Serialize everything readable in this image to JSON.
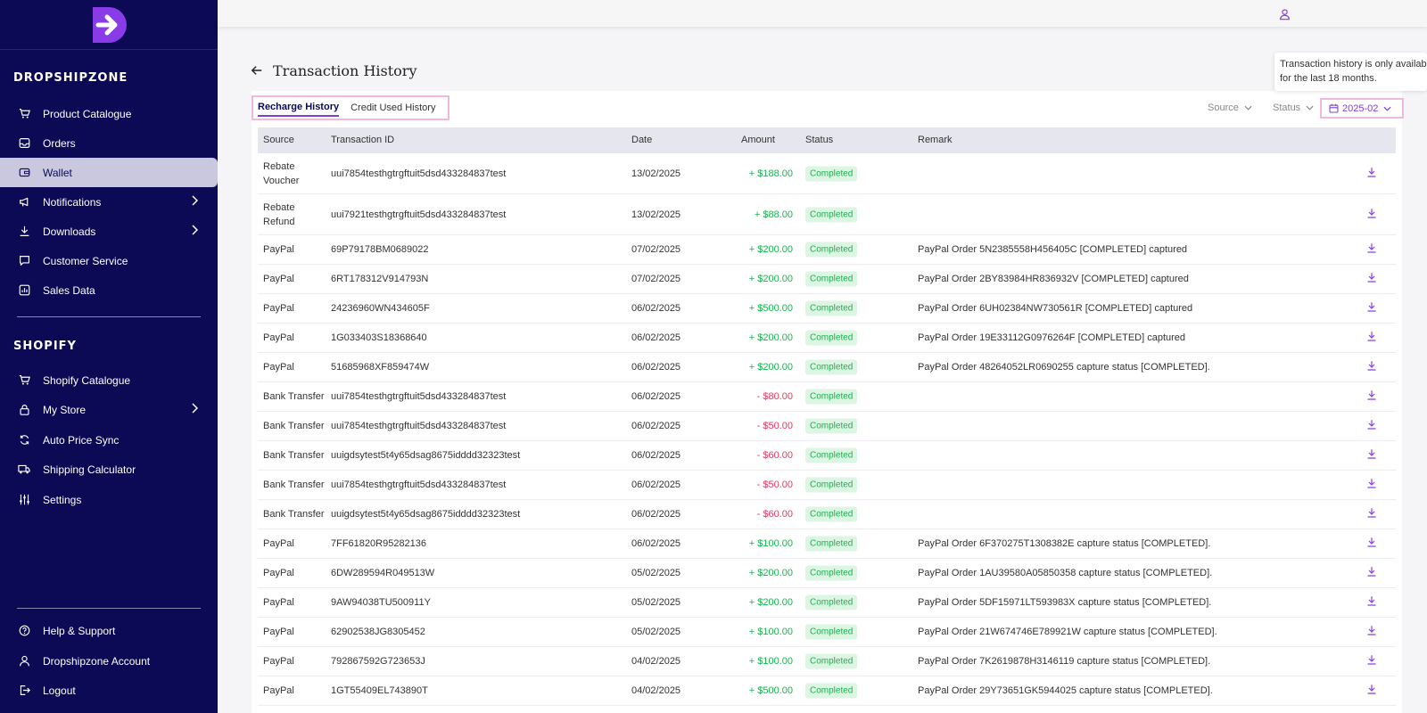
{
  "brand": {
    "logo_letter": "D"
  },
  "sidebar": {
    "dropshipzone_title": "DROPSHIPZONE",
    "shopify_title": "SHOPIFY",
    "items": [
      {
        "label": "Product Catalogue",
        "icon": "cart-icon"
      },
      {
        "label": "Orders",
        "icon": "inbox-icon"
      },
      {
        "label": "Wallet",
        "icon": "wallet-icon"
      },
      {
        "label": "Notifications",
        "icon": "megaphone-icon"
      },
      {
        "label": "Downloads",
        "icon": "download-icon"
      },
      {
        "label": "Customer Service",
        "icon": "chat-icon"
      },
      {
        "label": "Sales Data",
        "icon": "chart-icon"
      },
      {
        "label": "Shopify Catalogue",
        "icon": "cart-icon"
      },
      {
        "label": "My Store",
        "icon": "lock-icon"
      },
      {
        "label": "Auto Price Sync",
        "icon": "sync-icon"
      },
      {
        "label": "Shipping Calculator",
        "icon": "truck-icon"
      },
      {
        "label": "Settings",
        "icon": "sliders-icon"
      },
      {
        "label": "Help & Support",
        "icon": "help-icon"
      },
      {
        "label": "Dropshipzone Account",
        "icon": "user-icon"
      },
      {
        "label": "Logout",
        "icon": "logout-icon"
      }
    ]
  },
  "header": {
    "title": "Transaction History"
  },
  "tabs": [
    {
      "label": "Recharge History"
    },
    {
      "label": "Credit Used History"
    }
  ],
  "filters": {
    "source": "Source",
    "status": "Status",
    "date": "2025-02"
  },
  "tooltip": {
    "line1": "Transaction history is only available",
    "line2": "for the last 18 months."
  },
  "table": {
    "columns": {
      "source": "Source",
      "id": "Transaction ID",
      "date": "Date",
      "amount": "Amount",
      "status": "Status",
      "remark": "Remark"
    },
    "rows": [
      {
        "source": "Rebate Voucher",
        "id": "uui7854testhgtrgftuit5dsd433284837test",
        "date": "13/02/2025",
        "amount": "+ $188.00",
        "sign": "pos",
        "status": "Completed",
        "remark": ""
      },
      {
        "source": "Rebate Refund",
        "id": "uui7921testhgtrgftuit5dsd433284837test",
        "date": "13/02/2025",
        "amount": "+ $88.00",
        "sign": "pos",
        "status": "Completed",
        "remark": ""
      },
      {
        "source": "PayPal",
        "id": "69P79178BM0689022",
        "date": "07/02/2025",
        "amount": "+ $200.00",
        "sign": "pos",
        "status": "Completed",
        "remark": "PayPal Order 5N2385558H456405C [COMPLETED] captured"
      },
      {
        "source": "PayPal",
        "id": "6RT178312V914793N",
        "date": "07/02/2025",
        "amount": "+ $200.00",
        "sign": "pos",
        "status": "Completed",
        "remark": "PayPal Order 2BY83984HR836932V [COMPLETED] captured"
      },
      {
        "source": "PayPal",
        "id": "24236960WN434605F",
        "date": "06/02/2025",
        "amount": "+ $500.00",
        "sign": "pos",
        "status": "Completed",
        "remark": "PayPal Order 6UH02384NW730561R [COMPLETED] captured"
      },
      {
        "source": "PayPal",
        "id": "1G033403S18368640",
        "date": "06/02/2025",
        "amount": "+ $200.00",
        "sign": "pos",
        "status": "Completed",
        "remark": "PayPal Order 19E33112G0976264F [COMPLETED] captured"
      },
      {
        "source": "PayPal",
        "id": "51685968XF859474W",
        "date": "06/02/2025",
        "amount": "+ $200.00",
        "sign": "pos",
        "status": "Completed",
        "remark": "PayPal Order 48264052LR0690255 capture status [COMPLETED]."
      },
      {
        "source": "Bank Transfer",
        "id": "uui7854testhgtrgftuit5dsd433284837test",
        "date": "06/02/2025",
        "amount": "- $80.00",
        "sign": "neg",
        "status": "Completed",
        "remark": ""
      },
      {
        "source": "Bank Transfer",
        "id": "uui7854testhgtrgftuit5dsd433284837test",
        "date": "06/02/2025",
        "amount": "- $50.00",
        "sign": "neg",
        "status": "Completed",
        "remark": ""
      },
      {
        "source": "Bank Transfer",
        "id": "uuigdsytest5t4y65dsag8675idddd32323test",
        "date": "06/02/2025",
        "amount": "- $60.00",
        "sign": "neg",
        "status": "Completed",
        "remark": ""
      },
      {
        "source": "Bank Transfer",
        "id": "uui7854testhgtrgftuit5dsd433284837test",
        "date": "06/02/2025",
        "amount": "- $50.00",
        "sign": "neg",
        "status": "Completed",
        "remark": ""
      },
      {
        "source": "Bank Transfer",
        "id": "uuigdsytest5t4y65dsag8675idddd32323test",
        "date": "06/02/2025",
        "amount": "- $60.00",
        "sign": "neg",
        "status": "Completed",
        "remark": ""
      },
      {
        "source": "PayPal",
        "id": "7FF61820R95282136",
        "date": "06/02/2025",
        "amount": "+ $100.00",
        "sign": "pos",
        "status": "Completed",
        "remark": "PayPal Order 6F370275T1308382E capture status [COMPLETED]."
      },
      {
        "source": "PayPal",
        "id": "6DW289594R049513W",
        "date": "05/02/2025",
        "amount": "+ $200.00",
        "sign": "pos",
        "status": "Completed",
        "remark": "PayPal Order 1AU39580A05850358 capture status [COMPLETED]."
      },
      {
        "source": "PayPal",
        "id": "9AW94038TU500911Y",
        "date": "05/02/2025",
        "amount": "+ $200.00",
        "sign": "pos",
        "status": "Completed",
        "remark": "PayPal Order 5DF15971LT593983X capture status [COMPLETED]."
      },
      {
        "source": "PayPal",
        "id": "62902538JG8305452",
        "date": "05/02/2025",
        "amount": "+ $100.00",
        "sign": "pos",
        "status": "Completed",
        "remark": "PayPal Order 21W674746E789921W capture status [COMPLETED]."
      },
      {
        "source": "PayPal",
        "id": "792867592G723653J",
        "date": "04/02/2025",
        "amount": "+ $100.00",
        "sign": "pos",
        "status": "Completed",
        "remark": "PayPal Order 7K2619878H3146119 capture status [COMPLETED]."
      },
      {
        "source": "PayPal",
        "id": "1GT55409EL743890T",
        "date": "04/02/2025",
        "amount": "+ $500.00",
        "sign": "pos",
        "status": "Completed",
        "remark": "PayPal Order 29Y73651GK5944025 capture status [COMPLETED]."
      }
    ]
  },
  "colors": {
    "sidebar": "#0c0a55",
    "accent": "#7e3fd4",
    "positive": "#17b34d",
    "negative": "#e8385e"
  }
}
